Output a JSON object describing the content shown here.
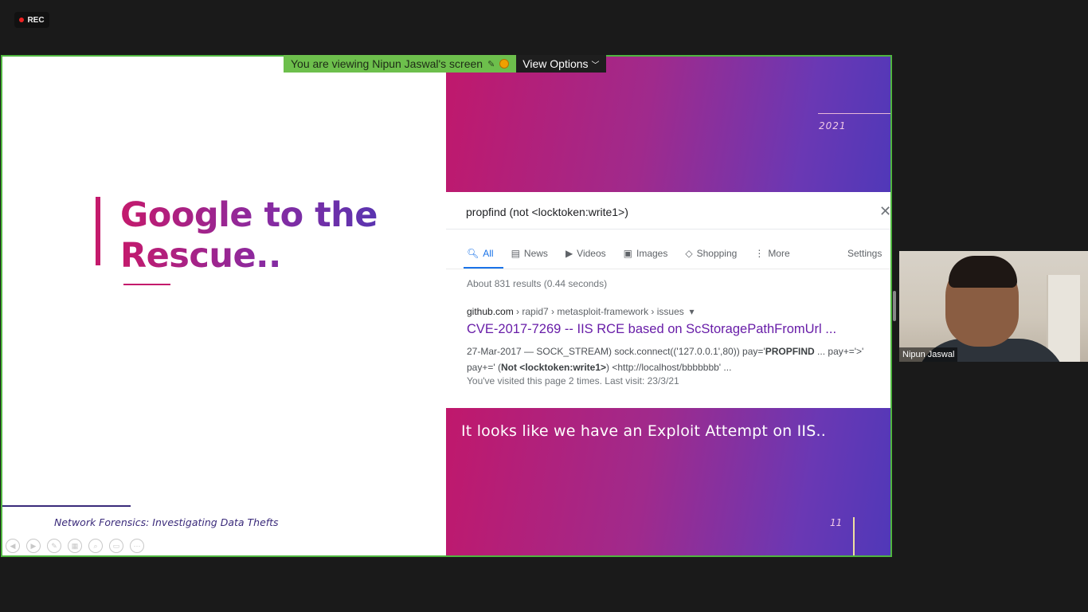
{
  "rec": {
    "label": "REC"
  },
  "banner": {
    "message": "You are viewing Nipun Jaswal's screen",
    "view_options": "View Options"
  },
  "slide_left": {
    "title_line1": "Google to the",
    "title_line2": "Rescue..",
    "footer": "Network Forensics: Investigating Data Thefts"
  },
  "slide_right": {
    "year": "2021",
    "slide_number": "11",
    "caption": "It looks like we have an Exploit Attempt on IIS.."
  },
  "google": {
    "query": "propfind (not <locktoken:write1>)",
    "tabs": [
      {
        "label": "All",
        "icon": "search-icon"
      },
      {
        "label": "News",
        "icon": "news-icon"
      },
      {
        "label": "Videos",
        "icon": "video-icon"
      },
      {
        "label": "Images",
        "icon": "image-icon"
      },
      {
        "label": "Shopping",
        "icon": "tag-icon"
      },
      {
        "label": "More",
        "icon": "more-vertical-icon"
      }
    ],
    "settings": "Settings",
    "stats": "About 831 results (0.44 seconds)",
    "result": {
      "domain": "github.com",
      "path": " › rapid7 › metasploit-framework › issues",
      "title": "CVE-2017-7269 -- IIS RCE based on ScStoragePathFromUrl ...",
      "snippet_part1": "27-Mar-2017 — SOCK_STREAM) sock.connect(('127.0.0.1',80)) pay='",
      "snippet_bold1": "PROPFIND",
      "snippet_part2": " ... pay+='>' pay+=' (",
      "snippet_bold2": "Not <locktoken:write1>",
      "snippet_part3": ") <http://localhost/bbbbbbb' ...",
      "visited": "You've visited this page 2 times. Last visit: 23/3/21"
    }
  },
  "participant": {
    "name": "Nipun Jaswal"
  },
  "colors": {
    "share_border": "#4fb640",
    "banner_bg": "#6dbf4c",
    "slide_magenta": "#c41a6c",
    "slide_purple": "#5a34b0",
    "link_visited": "#681da8"
  }
}
